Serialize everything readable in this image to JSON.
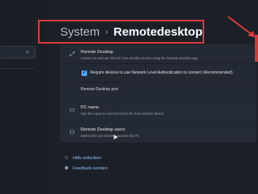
{
  "breadcrumb": {
    "parent": "System",
    "separator": "›",
    "current": "Remotedesktop"
  },
  "remote_desktop": {
    "title": "Remote Desktop",
    "subtitle": "Connect to and use this PC from another device using the Remote Desktop app",
    "icon": "remote-desktop-icon"
  },
  "nla": {
    "checked": true,
    "label": "Require devices to use Network Level Authentication to connect (Recommended)"
  },
  "port": {
    "label": "Remote Desktop port"
  },
  "pc_name": {
    "title": "PC name",
    "subtitle": "Use this name to connect to this PC from another device",
    "icon": "pc-icon"
  },
  "users": {
    "title": "Remote Desktop users",
    "subtitle": "Select who can remotely access this PC",
    "icon": "users-icon"
  },
  "links": [
    {
      "label": "Hilfe anfordern",
      "icon": "help-icon"
    },
    {
      "label": "Feedback senden",
      "icon": "feedback-icon"
    }
  ],
  "colors": {
    "accent": "#4ea8ff",
    "highlight": "#e23a3a",
    "background": "#1b2028"
  }
}
